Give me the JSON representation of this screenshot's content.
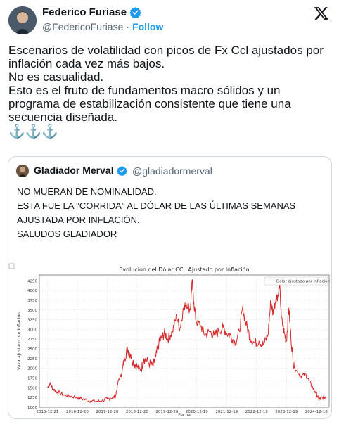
{
  "tweet": {
    "author_name": "Federico Furiase",
    "author_handle": "@FedericoFuriase",
    "separator": "·",
    "follow_label": "Follow",
    "text_lines": [
      "Escenarios de volatilidad con picos de Fx Ccl ajustados por",
      "inflación cada vez más bajos.",
      "No es casualidad.",
      "Esto es el fruto de fundamentos macro sólidos y un",
      "programa de estabilización consistente que tiene una",
      "secuencia diseñada.",
      "⚓⚓⚓"
    ]
  },
  "quote": {
    "author_name": "Gladiador Merval",
    "author_handle": "@gladiadormerval",
    "text_lines": [
      "NO MUERAN DE NOMINALIDAD.",
      "",
      "ESTA FUE LA \"CORRIDA\" AL DÓLAR DE LAS ÚLTIMAS SEMANAS",
      "AJUSTADA POR INFLACIÓN.",
      "",
      "SALUDOS GLADIADOR"
    ]
  },
  "colors": {
    "line": "#d62728",
    "link": "#1d9bf0",
    "verified": "#1d9bf0",
    "border": "#cfd9de",
    "muted": "#536471"
  },
  "chart_data": {
    "type": "line",
    "title": "Evolución del Dólar CCL Ajustado por Inflación",
    "xlabel": "Fecha",
    "ylabel": "Valor ajustado por inflación",
    "legend": "top-right",
    "grid": true,
    "ylim": [
      1000,
      4400
    ],
    "yticks": [
      1000,
      1250,
      1500,
      1750,
      2000,
      2250,
      2500,
      2750,
      3000,
      3250,
      3500,
      3750,
      4000,
      4250
    ],
    "xticks": [
      "2015-12-21",
      "2016-12-20",
      "2017-12-20",
      "2018-12-20",
      "2019-12-20",
      "2020-12-19",
      "2021-12-19",
      "2022-12-19",
      "2023-12-19",
      "2024-12-18"
    ],
    "xlim": [
      2015.7,
      2025.4
    ],
    "series": [
      {
        "name": "Dólar ajustado por inflación",
        "points": [
          [
            2015.97,
            1500
          ],
          [
            2016.05,
            1610
          ],
          [
            2016.15,
            1480
          ],
          [
            2016.3,
            1390
          ],
          [
            2016.5,
            1320
          ],
          [
            2016.7,
            1290
          ],
          [
            2016.97,
            1250
          ],
          [
            2017.2,
            1200
          ],
          [
            2017.4,
            1160
          ],
          [
            2017.6,
            1150
          ],
          [
            2017.8,
            1170
          ],
          [
            2017.97,
            1210
          ],
          [
            2018.1,
            1230
          ],
          [
            2018.25,
            1280
          ],
          [
            2018.35,
            1700
          ],
          [
            2018.45,
            1850
          ],
          [
            2018.55,
            2250
          ],
          [
            2018.65,
            2500
          ],
          [
            2018.75,
            2350
          ],
          [
            2018.85,
            2150
          ],
          [
            2018.97,
            2050
          ],
          [
            2019.1,
            1950
          ],
          [
            2019.2,
            2250
          ],
          [
            2019.35,
            2150
          ],
          [
            2019.5,
            2050
          ],
          [
            2019.6,
            2300
          ],
          [
            2019.7,
            2650
          ],
          [
            2019.8,
            2800
          ],
          [
            2019.9,
            2900
          ],
          [
            2020.0,
            2750
          ],
          [
            2020.15,
            2950
          ],
          [
            2020.3,
            3350
          ],
          [
            2020.4,
            3000
          ],
          [
            2020.5,
            3450
          ],
          [
            2020.6,
            3700
          ],
          [
            2020.75,
            3500
          ],
          [
            2020.81,
            4250
          ],
          [
            2020.87,
            3700
          ],
          [
            2020.95,
            3200
          ],
          [
            2021.1,
            3100
          ],
          [
            2021.25,
            2850
          ],
          [
            2021.4,
            2950
          ],
          [
            2021.55,
            2850
          ],
          [
            2021.7,
            2950
          ],
          [
            2021.85,
            3050
          ],
          [
            2021.97,
            2900
          ],
          [
            2022.1,
            2850
          ],
          [
            2022.25,
            2650
          ],
          [
            2022.4,
            2950
          ],
          [
            2022.5,
            3550
          ],
          [
            2022.6,
            3200
          ],
          [
            2022.75,
            2800
          ],
          [
            2022.9,
            2650
          ],
          [
            2023.05,
            2700
          ],
          [
            2023.2,
            2600
          ],
          [
            2023.35,
            2850
          ],
          [
            2023.45,
            3750
          ],
          [
            2023.52,
            3400
          ],
          [
            2023.62,
            3800
          ],
          [
            2023.7,
            3900
          ],
          [
            2023.74,
            4200
          ],
          [
            2023.8,
            3300
          ],
          [
            2023.9,
            2900
          ],
          [
            2023.97,
            2700
          ],
          [
            2024.05,
            3550
          ],
          [
            2024.12,
            2800
          ],
          [
            2024.2,
            2150
          ],
          [
            2024.3,
            1950
          ],
          [
            2024.45,
            1800
          ],
          [
            2024.6,
            1850
          ],
          [
            2024.72,
            1700
          ],
          [
            2024.85,
            1500
          ],
          [
            2024.97,
            1350
          ],
          [
            2025.05,
            1200
          ],
          [
            2025.12,
            1220
          ],
          [
            2025.2,
            1250
          ],
          [
            2025.3,
            1260
          ]
        ]
      }
    ]
  }
}
